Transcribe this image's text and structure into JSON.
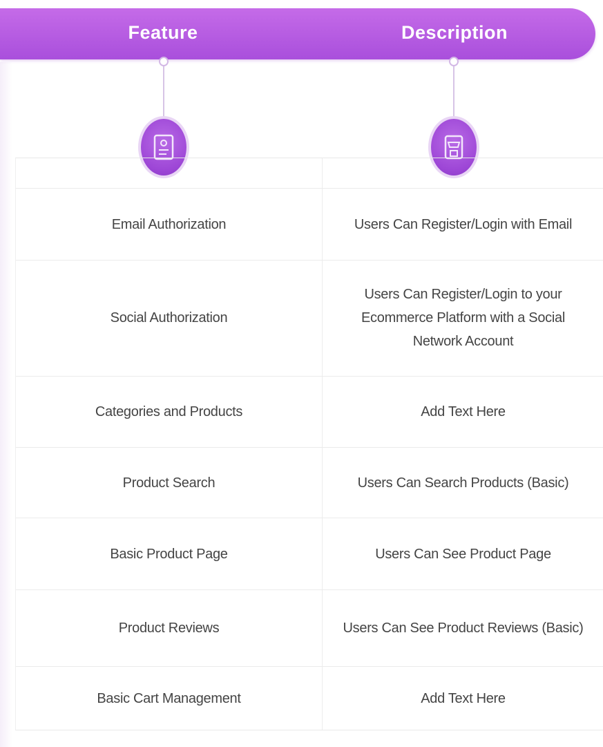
{
  "header": {
    "feature_label": "Feature",
    "description_label": "Description",
    "accent_color": "#b359e3"
  },
  "icons": {
    "feature": "document-icon",
    "description": "store-icon"
  },
  "rows": [
    {
      "feature": "Email Authorization",
      "description": "Users Can Register/Login with Email"
    },
    {
      "feature": "Social Authorization",
      "description": "Users Can Register/Login to your Ecommerce Platform with a Social Network Account"
    },
    {
      "feature": "Categories and Products",
      "description": "Add Text Here"
    },
    {
      "feature": "Product Search",
      "description": "Users Can Search Products (Basic)"
    },
    {
      "feature": "Basic Product Page",
      "description": "Users Can See Product Page"
    },
    {
      "feature": "Product Reviews",
      "description": "Users Can See Product Reviews (Basic)"
    },
    {
      "feature": "Basic Cart Management",
      "description": "Add Text Here"
    }
  ]
}
